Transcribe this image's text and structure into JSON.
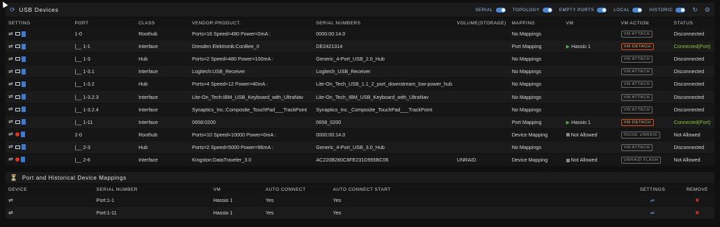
{
  "header": {
    "title": "USB Devices",
    "toggles": [
      "SERIAL",
      "TOPOLOGY",
      "EMPTY PORTS",
      "LOCAL",
      "HISTORIC"
    ]
  },
  "columns": [
    "SETTING",
    "PORT",
    "CLASS",
    "VENDOR:PRODUCT.",
    "SERIAL NUMBERS",
    "VOLUME(STORAGE)",
    "MAPPING",
    "VM",
    "VM ACTION",
    "STATUS"
  ],
  "rows": [
    {
      "port": "1-0",
      "class": "Roothub",
      "vendor": "Ports=16 Speed=480 Power=0mA :",
      "serial": "0000:00:14.0",
      "volume": "",
      "mapping": "No Mappings",
      "vm": "",
      "vm_type": "none",
      "action": "VM ATTACH",
      "action_state": "inactive",
      "status": "Disconnected",
      "status_state": "normal",
      "icon": "monitor"
    },
    {
      "port": "|__ 1-1",
      "class": "Interface",
      "vendor": "Dresden Elektronik:ConBee_II",
      "serial": "DE2421314",
      "volume": "",
      "mapping": "Port Mapping",
      "vm": "Hassio 1",
      "vm_type": "play",
      "action": "VM DETACH",
      "action_state": "active",
      "status": "Connected(Port)",
      "status_state": "connected",
      "icon": "monitor"
    },
    {
      "port": "|__ 1-3",
      "class": "Hub",
      "vendor": "Ports=2 Speed=480 Power=100mA :",
      "serial": "Generic_4-Port_USB_2.0_Hub",
      "volume": "",
      "mapping": "No Mappings",
      "vm": "",
      "vm_type": "none",
      "action": "VM ATTACH",
      "action_state": "inactive",
      "status": "Disconnected",
      "status_state": "normal",
      "icon": "monitor"
    },
    {
      "port": "|__ 1-3.1",
      "class": "Interface",
      "vendor": "Logitech:USB_Receiver",
      "serial": "Logitech_USB_Receiver",
      "volume": "",
      "mapping": "No Mappings",
      "vm": "",
      "vm_type": "none",
      "action": "VM ATTACH",
      "action_state": "inactive",
      "status": "Disconnected",
      "status_state": "normal",
      "icon": "monitor"
    },
    {
      "port": "|__ 1-3.2",
      "class": "Hub",
      "vendor": "Ports=4 Speed=12 Power=40mA :",
      "serial": "Lite-On_Tech_USB_1.1_2_port_downstream_low-power_hub",
      "volume": "",
      "mapping": "No Mappings",
      "vm": "",
      "vm_type": "none",
      "action": "VM ATTACH",
      "action_state": "inactive",
      "status": "Disconnected",
      "status_state": "normal",
      "icon": "monitor"
    },
    {
      "port": "|__ 1-3.2.3",
      "class": "Interface",
      "vendor": "Lite-On_Tech:IBM_USB_Keyboard_with_UltraNav",
      "serial": "Lite-On_Tech_IBM_USB_Keyboard_with_UltraNav",
      "volume": "",
      "mapping": "No Mappings",
      "vm": "",
      "vm_type": "none",
      "action": "VM ATTACH",
      "action_state": "inactive",
      "status": "Disconnected",
      "status_state": "normal",
      "icon": "monitor"
    },
    {
      "port": "|__ 1-3.2.4",
      "class": "Interface",
      "vendor": "Synaptics_Inc.:Composite_TouchPad___TrackPoint",
      "serial": "Synaptics_Inc._Composite_TouchPad___TrackPoint",
      "volume": "",
      "mapping": "No Mappings",
      "vm": "",
      "vm_type": "none",
      "action": "VM ATTACH",
      "action_state": "inactive",
      "status": "Disconnected",
      "status_state": "normal",
      "icon": "monitor"
    },
    {
      "port": "|__ 1-11",
      "class": "Interface",
      "vendor": "0658:0200",
      "serial": "0658_0200",
      "volume": "",
      "mapping": "Port Mapping",
      "vm": "Hassio 1",
      "vm_type": "play",
      "action": "VM DETACH",
      "action_state": "active",
      "status": "Connected(Port)",
      "status_state": "connected",
      "icon": "monitor"
    },
    {
      "port": "2-0",
      "class": "Roothub",
      "vendor": "Ports=10 Speed=10000 Power=0mA :",
      "serial": "0000:00:14.0",
      "volume": "",
      "mapping": "Device Mapping",
      "vm": "Not Allowed",
      "vm_type": "stop",
      "action": "INUSE UNRAID",
      "action_state": "inactive",
      "status": "Not Allowed",
      "status_state": "normal",
      "icon": "red"
    },
    {
      "port": "|__ 2-3",
      "class": "Hub",
      "vendor": "Ports=2 Speed=5000 Power=96mA :",
      "serial": "Generic_4-Port_USB_3.0_Hub",
      "volume": "",
      "mapping": "No Mappings",
      "vm": "",
      "vm_type": "none",
      "action": "VM ATTACH",
      "action_state": "inactive",
      "status": "Disconnected",
      "status_state": "normal",
      "icon": "monitor"
    },
    {
      "port": "|__ 2-6",
      "class": "Interface",
      "vendor": "Kingston:DataTraveler_3.0",
      "serial": "AC220B280C8FE231D955BC06",
      "volume": "UNRAID",
      "mapping": "Device Mapping",
      "vm": "Not Allowed",
      "vm_type": "stop",
      "action": "UNRAID FLASH",
      "action_state": "inactive",
      "status": "Not Allowed",
      "status_state": "normal",
      "icon": "red"
    }
  ],
  "mappings_section": {
    "title": "Port and Historical Device Mappings",
    "columns": [
      "DEVICE",
      "SERIAL NUMBER",
      "VM",
      "AUTO CONNECT",
      "AUTO CONNECT START",
      "SETTINGS",
      "REMOVE"
    ],
    "rows": [
      {
        "serial": "Port:1-1",
        "vm": "Hassio 1",
        "auto_connect": "Yes",
        "auto_connect_start": "Yes"
      },
      {
        "serial": "Port:1-11",
        "vm": "Hassio 1",
        "auto_connect": "Yes",
        "auto_connect_start": "Yes"
      }
    ]
  },
  "colors": {
    "accent": "#4a87d6",
    "detach": "#d8531f",
    "connected": "#8fc43a",
    "remove": "#d9342b"
  }
}
